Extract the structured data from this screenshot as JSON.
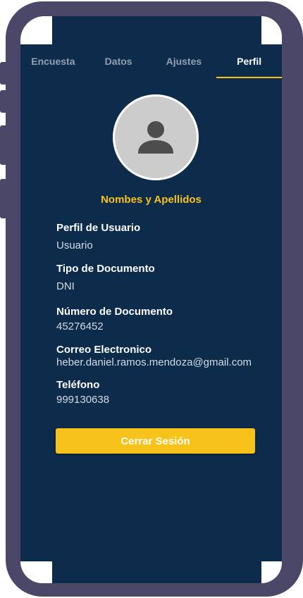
{
  "tabs": [
    {
      "label": "Encuesta"
    },
    {
      "label": "Datos"
    },
    {
      "label": "Ajustes"
    },
    {
      "label": "Perfil"
    }
  ],
  "active_tab": "Perfil",
  "profile": {
    "name": "Nombes y Apellidos",
    "avatar_icon": "person-icon"
  },
  "fields": [
    {
      "label": "Perfil de Usuario",
      "value": "Usuario"
    },
    {
      "label": "Tipo de Documento",
      "value": "DNI"
    },
    {
      "label": "Número de Documento",
      "value": "45276452"
    },
    {
      "label": "Correo Electronico",
      "value": "heber.daniel.ramos.mendoza@gmail.com"
    },
    {
      "label": "Teléfono",
      "value": "999130638"
    }
  ],
  "logout_label": "Cerrar Sesión",
  "colors": {
    "background": "#0d2c4b",
    "accent": "#f7c21a",
    "frame": "#4a4768"
  }
}
